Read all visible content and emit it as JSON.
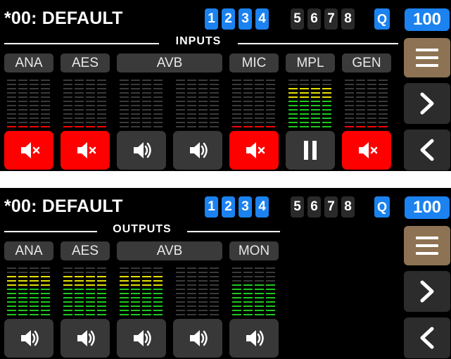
{
  "inputs_panel": {
    "title": "*00: DEFAULT",
    "scenes": [
      {
        "label": "1",
        "active": true
      },
      {
        "label": "2",
        "active": true
      },
      {
        "label": "3",
        "active": true
      },
      {
        "label": "4",
        "active": true
      },
      {
        "label": "5",
        "active": false
      },
      {
        "label": "6",
        "active": false
      },
      {
        "label": "7",
        "active": false
      },
      {
        "label": "8",
        "active": false
      }
    ],
    "q_label": "Q",
    "level_label": "100",
    "section_label": "INPUTS",
    "channels": [
      {
        "label": "ANA",
        "meter_green": 0,
        "meter_yellow": 0,
        "red_line": true,
        "state": "muted"
      },
      {
        "label": "AES",
        "meter_green": 0,
        "meter_yellow": 0,
        "red_line": true,
        "state": "muted"
      },
      {
        "label": "AVB",
        "meter_green": 0,
        "meter_yellow": 0,
        "red_line": false,
        "state": "on"
      },
      {
        "label": "",
        "meter_green": 0,
        "meter_yellow": 0,
        "red_line": false,
        "state": "on"
      },
      {
        "label": "MIC",
        "meter_green": 0,
        "meter_yellow": 0,
        "red_line": true,
        "state": "muted"
      },
      {
        "label": "MPL",
        "meter_green": 7,
        "meter_yellow": 3,
        "red_line": false,
        "state": "paused"
      },
      {
        "label": "GEN",
        "meter_green": 0,
        "meter_yellow": 0,
        "red_line": true,
        "state": "muted"
      }
    ]
  },
  "outputs_panel": {
    "title": "*00: DEFAULT",
    "scenes": [
      {
        "label": "1",
        "active": true
      },
      {
        "label": "2",
        "active": true
      },
      {
        "label": "3",
        "active": true
      },
      {
        "label": "4",
        "active": true
      },
      {
        "label": "5",
        "active": false
      },
      {
        "label": "6",
        "active": false
      },
      {
        "label": "7",
        "active": false
      },
      {
        "label": "8",
        "active": false
      }
    ],
    "q_label": "Q",
    "level_label": "100",
    "section_label": "OUTPUTS",
    "channels": [
      {
        "label": "ANA",
        "meter_green": 7,
        "meter_yellow": 3,
        "red_line": false,
        "state": "on"
      },
      {
        "label": "AES",
        "meter_green": 7,
        "meter_yellow": 3,
        "red_line": false,
        "state": "on"
      },
      {
        "label": "AVB",
        "meter_green": 7,
        "meter_yellow": 3,
        "red_line": false,
        "state": "on"
      },
      {
        "label": "",
        "meter_green": 0,
        "meter_yellow": 0,
        "red_line": false,
        "state": "on"
      },
      {
        "label": "MON",
        "meter_green": 8,
        "meter_yellow": 0,
        "red_line": false,
        "state": "on"
      }
    ]
  },
  "side_buttons": {
    "menu_icon": "hamburger-icon",
    "next_icon": "chevron-right-icon",
    "back_icon": "chevron-left-icon"
  },
  "colors": {
    "accent_blue": "#1b82f0",
    "mute_red": "#ff0000",
    "menu_brown": "#8d7353",
    "meter_green": "#1ec81e",
    "meter_yellow": "#e8e000",
    "meter_idle": "#3a3a3a"
  }
}
